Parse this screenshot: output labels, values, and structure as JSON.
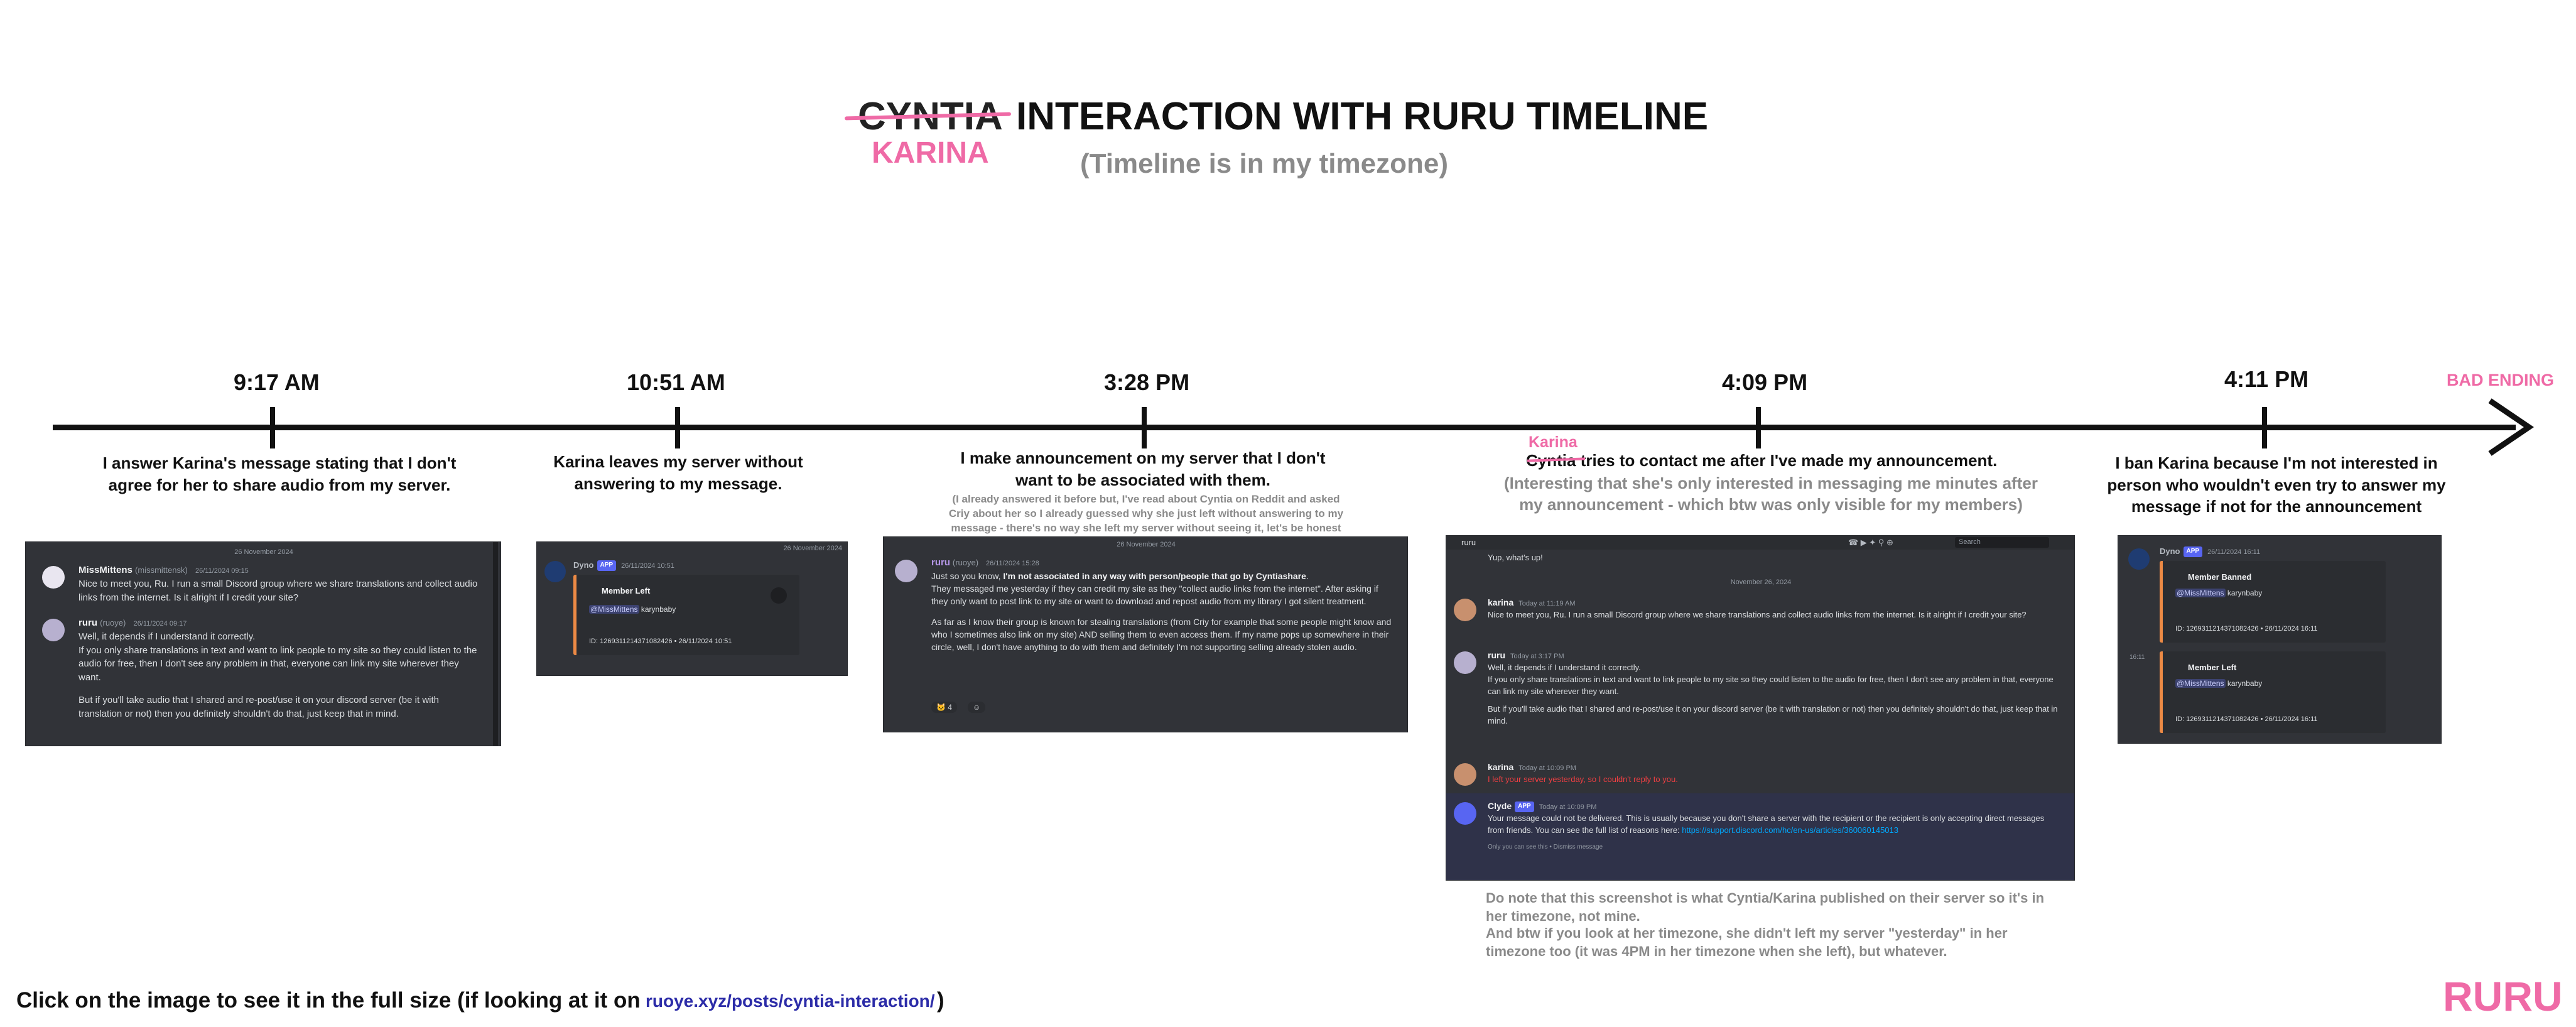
{
  "header": {
    "struck_name": "CYNTIA",
    "title": "INTERACTION WITH RURU TIMELINE",
    "corrected_name": "KARINA",
    "subtitle": "(Timeline is in my timezone)"
  },
  "timeline": {
    "ending_label": "BAD ENDING",
    "events": [
      {
        "time": "9:17 AM",
        "description": "I answer Karina's message stating that I don't agree for her to share audio from my server.",
        "screenshot": {
          "date": "26 November 2024",
          "messages": [
            {
              "name": "MissMittens",
              "handle": "(missmittensk)",
              "time": "26/11/2024 09:15",
              "text": "Nice to meet you, Ru. I run a small Discord group where we share translations and collect audio links from the internet. Is it alright if I credit your site?"
            },
            {
              "name": "ruru",
              "handle": "(ruoye)",
              "time": "26/11/2024 09:17",
              "text1": "Well, it depends if I understand it correctly.",
              "text2": "If you only share translations in text and want to link people to my site so they could listen to the audio for free, then I don't see any problem in that, everyone can link my site wherever they want.",
              "text3": "But if you'll take audio that I shared and re-post/use it on your discord server (be it with translation or not) then you definitely shouldn't do that, just keep that in mind."
            }
          ]
        }
      },
      {
        "time": "10:51 AM",
        "description": "Karina leaves my server without answering to my message.",
        "screenshot": {
          "bot": "Dyno",
          "badge": "APP",
          "time": "26/11/2024 10:51",
          "date": "26 November 2024",
          "embed_title": "Member Left",
          "mention": "@MissMittens",
          "user": "karynbaby",
          "footer": "ID: 1269311214371082426 • 26/11/2024 10:51"
        }
      },
      {
        "time": "3:28 PM",
        "description": "I make announcement on my server that I don't want to be associated with them.",
        "note": "(I already answered it before but, I've read about Cyntia on Reddit and asked Criy about her so I already guessed why she just left without answering to my message - there's no way she left my server without seeing it, let's be honest here)",
        "screenshot": {
          "date": "26 November 2024",
          "name": "ruru",
          "handle": "(ruoye)",
          "time": "26/11/2024 15:28",
          "text_pre": "Just so you know, ",
          "text_bold": "I'm not associated in any way with person/people that go by Cyntiashare",
          "text_post": ".",
          "text2": "They messaged me yesterday if they can credit my site as they \"collect audio links from the internet\". After asking if they only want to post link to my site or want to download and repost audio from my library I got silent treatment.",
          "text3": "As far as I know their group is known for stealing translations (from Criy for example that some people might know and who I sometimes also link on my site) AND selling them to even access them. If my name pops up somewhere in their circle, well, I don't have anything to do with them and definitely I'm not supporting selling already stolen audio.",
          "reaction_count": "4"
        }
      },
      {
        "time": "4:09 PM",
        "struck_name": "Cyntia",
        "corrected_name": "Karina",
        "description": "tries to contact me after I've made my announcement.",
        "note": "(Interesting that she's only interested in messaging me minutes after my announcement - which btw was only visible for my members)",
        "screenshot": {
          "channel": "ruru",
          "search": "Search",
          "top_text": "Yup, what's up!",
          "date": "November 26, 2024",
          "messages": [
            {
              "name": "karina",
              "time": "Today at 11:19 AM",
              "text": "Nice to meet you, Ru. I run a small Discord group where we share translations and collect audio links from the internet. Is it alright if I credit your site?"
            },
            {
              "name": "ruru",
              "time": "Today at 3:17 PM",
              "text1": "Well, it depends if I understand it correctly.",
              "text2": "If you only share translations in text and want to link people to my site so they could listen to the audio for free, then I don't see any problem in that, everyone can link my site wherever they want.",
              "text3": "But if you'll take audio that I shared and re-post/use it on your discord server (be it with translation or not) then you definitely shouldn't do that, just keep that in mind."
            },
            {
              "name": "karina",
              "time": "Today at 10:09 PM",
              "text": "I left your server yesterday, so I couldn't reply to you."
            },
            {
              "name": "Clyde",
              "badge": "APP",
              "time": "Today at 10:09 PM",
              "text": "Your message could not be delivered. This is usually because you don't share a server with the recipient or the recipient is only accepting direct messages from friends. You can see the full list of reasons here: ",
              "link": "https://support.discord.com/hc/en-us/articles/360060145013",
              "ephemeral": "Only you can see this • Dismiss message"
            }
          ]
        },
        "footnote1": "Do note that this screenshot is what Cyntia/Karina published on their server so it's in her timezone, not mine.",
        "footnote2": "And btw if you look at her timezone, she didn't left my server \"yesterday\" in her timezone too (it was 4PM in her timezone when she left), but whatever."
      },
      {
        "time": "4:11 PM",
        "description": "I ban Karina because I'm not interested in person who wouldn't even try to answer my message if not for the announcement",
        "screenshot": {
          "bot": "Dyno",
          "badge": "APP",
          "time": "26/11/2024 16:11",
          "side_time": "16:11",
          "embeds": [
            {
              "title": "Member Banned",
              "mention": "@MissMittens",
              "user": "karynbaby",
              "footer": "ID: 1269311214371082426 • 26/11/2024 16:11"
            },
            {
              "title": "Member Left",
              "mention": "@MissMittens",
              "user": "karynbaby",
              "footer": "ID: 1269311214371082426 • 26/11/2024 16:11"
            }
          ]
        }
      }
    ]
  },
  "footer": {
    "text": "Click on the image to see it in the full size (if looking at it on",
    "link": "ruoye.xyz/posts/cyntia-interaction/",
    "close": ")"
  },
  "brand": "RURU",
  "colors": {
    "accent_pink": "#ef6aa6",
    "discord_bg": "#313338",
    "embed_orange": "#ed8a45",
    "link_blue": "#00a8fc",
    "app_badge": "#5865f2"
  }
}
